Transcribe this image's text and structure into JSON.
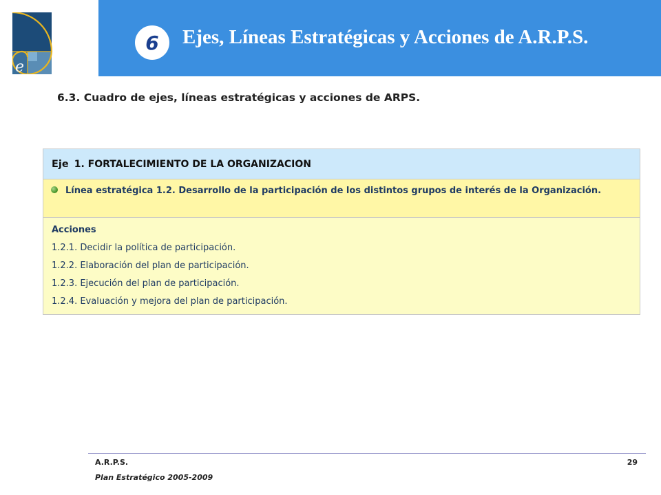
{
  "header": {
    "chapter_number": "6",
    "title": "Ejes, Líneas Estratégicas y Acciones de A.R.P.S.",
    "bar_color": "#3b8fe0"
  },
  "section": {
    "title": "6.3. Cuadro de ejes, líneas estratégicas y acciones de ARPS."
  },
  "table": {
    "eje_label": "Eje",
    "eje_text": "1. FORTALECIMIENTO DE LA ORGANIZACION",
    "linea": "Línea estratégica 1.2. Desarrollo de la participación de los distintos grupos de interés de la Organización.",
    "acciones_label": "Acciones",
    "acciones": [
      "1.2.1. Decidir la política de participación.",
      "1.2.2. Elaboración del plan de participación.",
      "1.2.3. Ejecución del plan de participación.",
      "1.2.4. Evaluación y mejora del plan de participación."
    ],
    "colors": {
      "eje_bg": "#cde9fb",
      "linea_bg": "#fff7a6",
      "acciones_bg": "#fdfcc6"
    }
  },
  "footer": {
    "org": "A.R.P.S.",
    "plan": "Plan Estratégico 2005-2009",
    "page": "29"
  },
  "icons": [
    "golden-ratio-logo-icon",
    "green-bullet-icon"
  ]
}
